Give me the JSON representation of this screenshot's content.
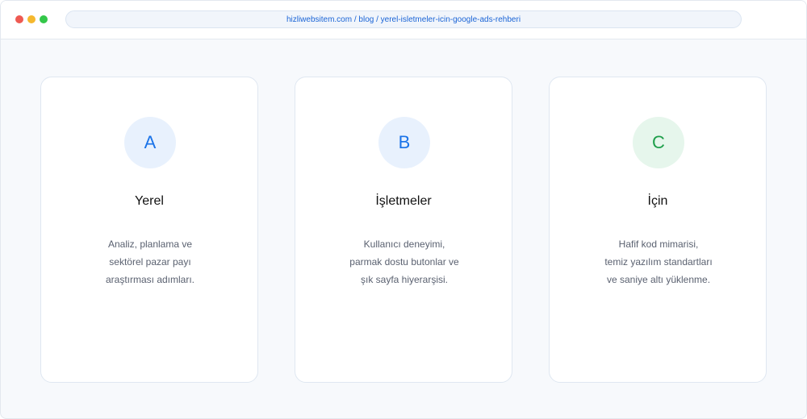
{
  "browser": {
    "url": "hizliwebsitem.com / blog / yerel-isletmeler-icin-google-ads-rehberi",
    "colors": {
      "close": "#ee5a52",
      "minimize": "#f5b82e",
      "maximize": "#34c749"
    }
  },
  "cards": [
    {
      "letter": "A",
      "title": "Yerel",
      "lines": [
        "Analiz, planlama ve",
        "sektörel pazar payı",
        "araştırması adımları."
      ],
      "badge_bg": "#e8f1fd",
      "badge_color": "#1a73e8"
    },
    {
      "letter": "B",
      "title": "İşletmeler",
      "lines": [
        "Kullanıcı deneyimi,",
        "parmak dostu butonlar ve",
        "şık sayfa hiyerarşisi."
      ],
      "badge_bg": "#e8f1fd",
      "badge_color": "#1a73e8"
    },
    {
      "letter": "C",
      "title": "İçin",
      "lines": [
        "Hafif kod mimarisi,",
        "temiz yazılım standartları",
        "ve saniye altı yüklenme."
      ],
      "badge_bg": "#e6f6ec",
      "badge_color": "#1e9e4a"
    }
  ]
}
